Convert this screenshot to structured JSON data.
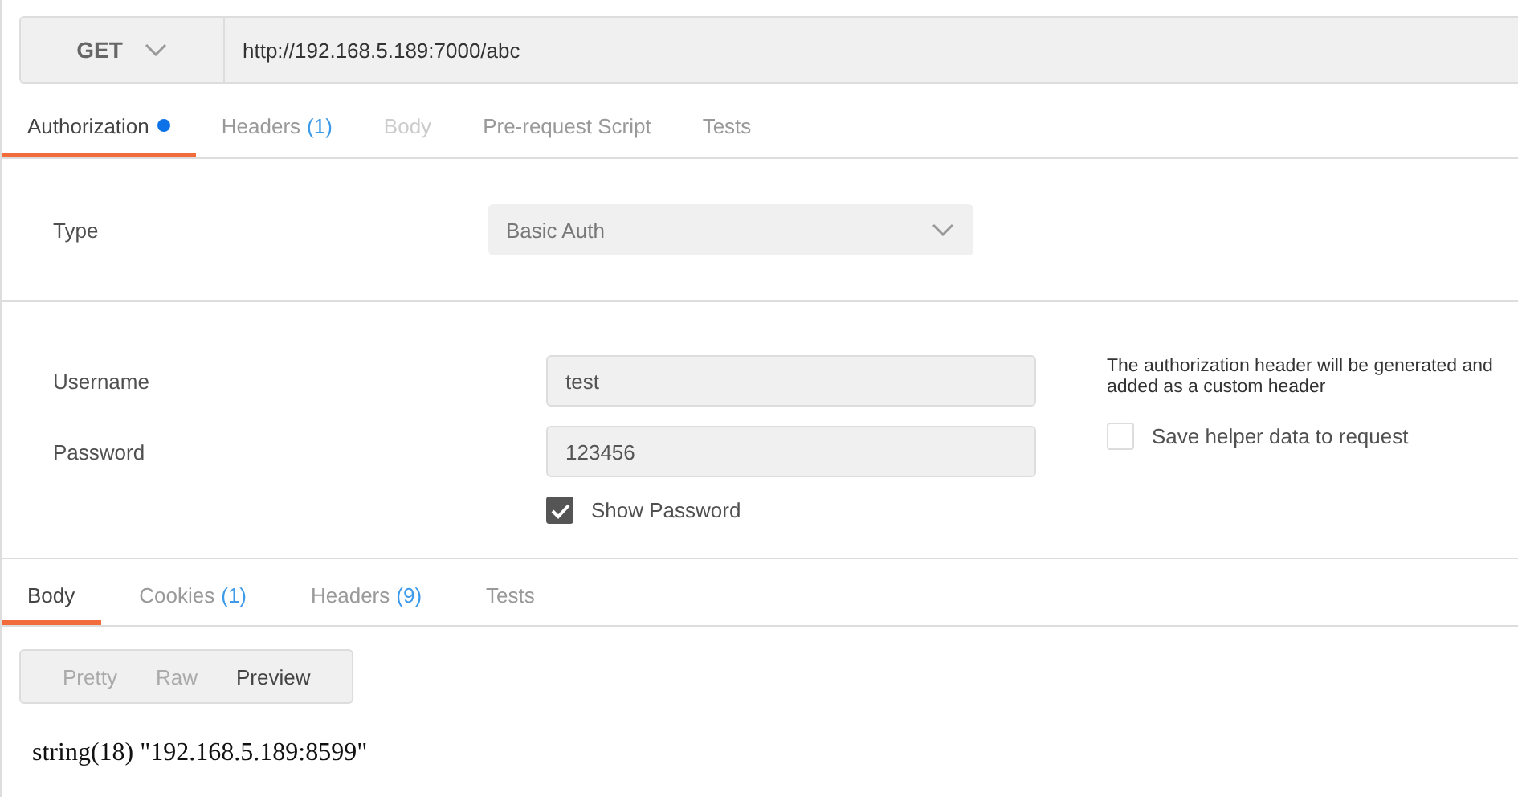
{
  "request": {
    "method": "GET",
    "url": "http://192.168.5.189:7000/abc"
  },
  "request_tabs": [
    {
      "label": "Authorization",
      "dot": true,
      "selected": true,
      "disabled": false
    },
    {
      "label": "Headers",
      "count": "(1)",
      "selected": false,
      "disabled": false
    },
    {
      "label": "Body",
      "selected": false,
      "disabled": true
    },
    {
      "label": "Pre-request Script",
      "selected": false,
      "disabled": false
    },
    {
      "label": "Tests",
      "selected": false,
      "disabled": false
    }
  ],
  "auth": {
    "type_label": "Type",
    "type_value": "Basic Auth",
    "username_label": "Username",
    "username": "test",
    "password_label": "Password",
    "password": "123456",
    "show_password": {
      "label": "Show Password",
      "checked": true
    },
    "help_text": "The authorization header will be generated and added as a custom header",
    "save_helper": {
      "label": "Save helper data to request",
      "checked": false
    }
  },
  "response_tabs": [
    {
      "label": "Body",
      "selected": true
    },
    {
      "label": "Cookies",
      "count": "(1)",
      "selected": false
    },
    {
      "label": "Headers",
      "count": "(9)",
      "selected": false
    },
    {
      "label": "Tests",
      "selected": false
    }
  ],
  "view_modes": [
    {
      "label": "Pretty",
      "selected": false
    },
    {
      "label": "Raw",
      "selected": false
    },
    {
      "label": "Preview",
      "selected": true
    }
  ],
  "output": "string(18) \"192.168.5.189:8599\""
}
